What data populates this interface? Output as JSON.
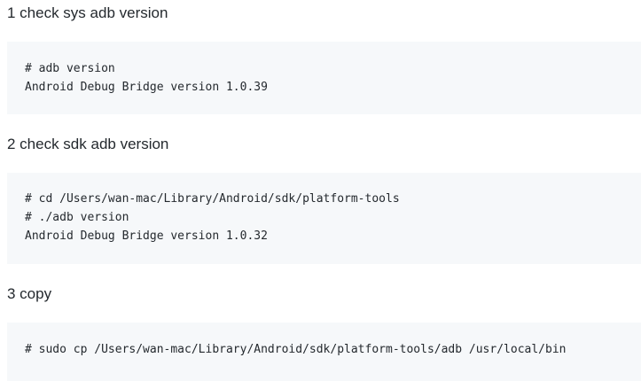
{
  "sections": [
    {
      "heading": "1 check sys adb version",
      "code_lines": [
        "# adb version",
        "Android Debug Bridge version 1.0.39"
      ]
    },
    {
      "heading": "2 check sdk adb version",
      "code_lines": [
        "# cd /Users/wan-mac/Library/Android/sdk/platform-tools",
        "# ./adb version",
        "Android Debug Bridge version 1.0.32"
      ]
    },
    {
      "heading": "3 copy",
      "code_lines": [
        "# sudo cp /Users/wan-mac/Library/Android/sdk/platform-tools/adb /usr/local/bin"
      ]
    }
  ]
}
